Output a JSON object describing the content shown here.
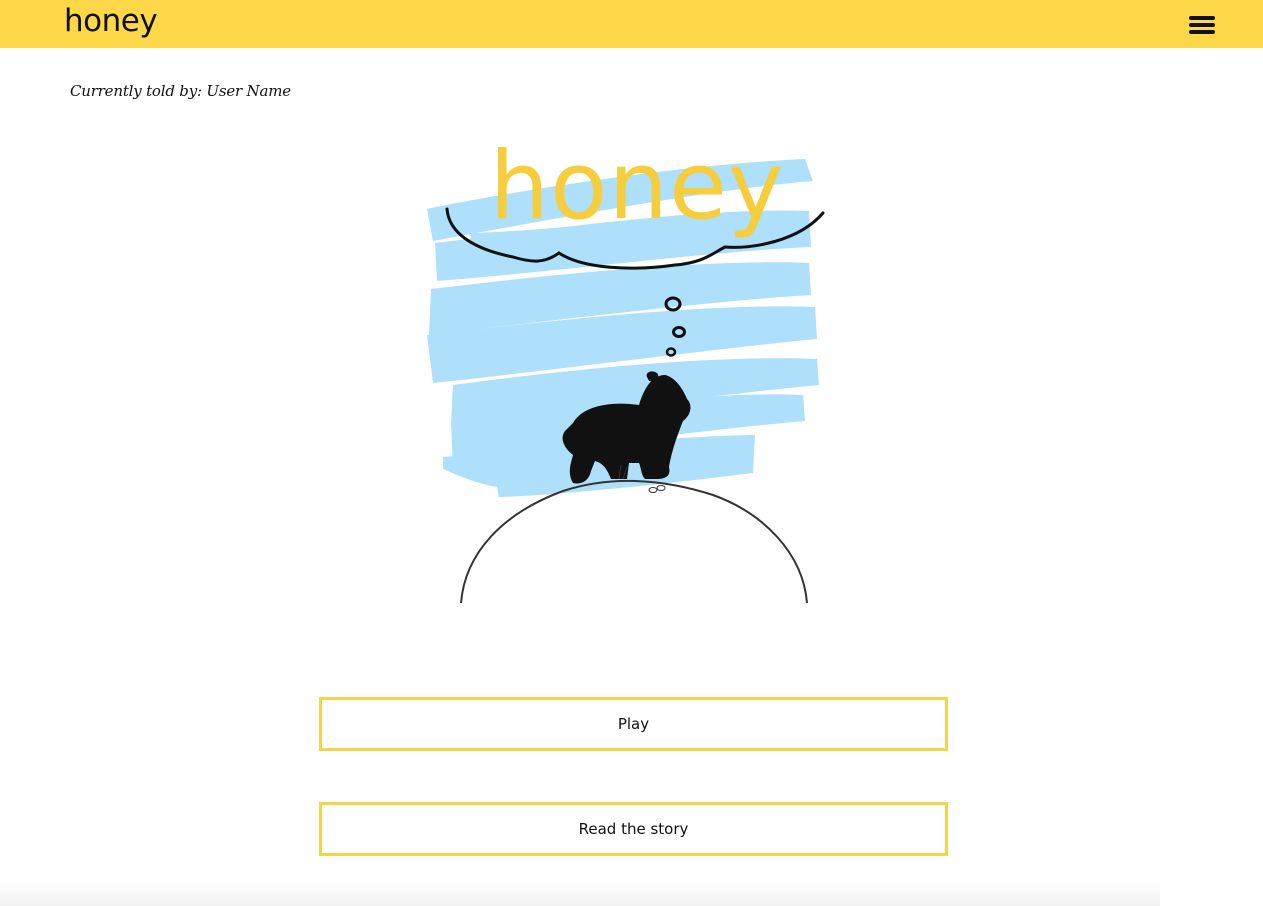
{
  "header": {
    "brand": "honey",
    "menu_icon": "hamburger-menu-icon",
    "background": "#ffd84a"
  },
  "story": {
    "told_by": "Currently told by: User Name",
    "cover": {
      "title": "honey",
      "title_color": "#f6cd3c",
      "scribble_color": "#aedffb",
      "illustration": "bear-on-hill-dreaming-illustration"
    }
  },
  "actions": {
    "play_label": "Play",
    "read_label": "Read the story",
    "border_color": "#f5d547"
  }
}
